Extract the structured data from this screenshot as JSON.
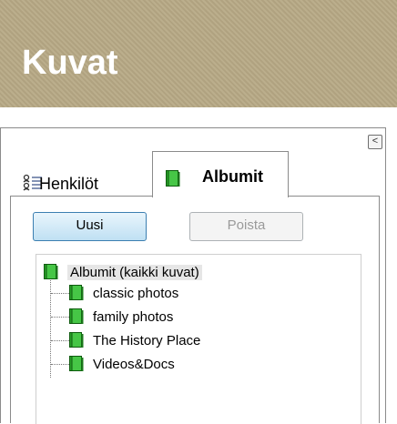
{
  "header": {
    "title": "Kuvat"
  },
  "panel": {
    "collapse_glyph": "<",
    "tabs": [
      {
        "label": "Henkilöt",
        "icon": "persons-list-icon",
        "active": false
      },
      {
        "label": "Albumit",
        "icon": "album-book-icon",
        "active": true
      }
    ],
    "buttons": {
      "new": "Uusi",
      "delete": "Poista"
    },
    "tree": {
      "root": "Albumit (kaikki kuvat)",
      "items": [
        "classic photos",
        "family photos",
        "The History Place",
        "Videos&Docs"
      ]
    }
  },
  "colors": {
    "header_bg": "#b7a985",
    "album_icon_green": "#2aa12a",
    "button_blue_border": "#3c7fb1"
  }
}
